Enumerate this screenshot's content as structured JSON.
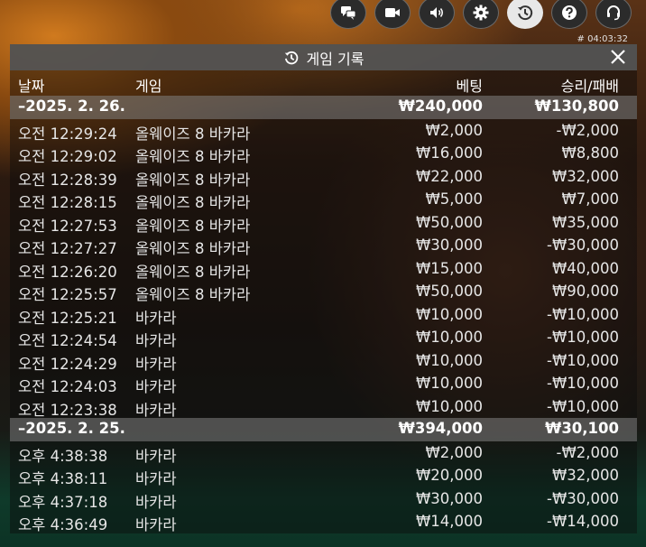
{
  "toolbar": {
    "buttons": [
      {
        "icon": "chat-icon"
      },
      {
        "icon": "video-icon"
      },
      {
        "icon": "volume-icon"
      },
      {
        "icon": "gear-icon"
      },
      {
        "icon": "history-icon",
        "active": true
      },
      {
        "icon": "help-icon"
      },
      {
        "icon": "headset-icon"
      }
    ],
    "clock": "# 04:03:32"
  },
  "panel": {
    "title": "게임 기록",
    "columns": {
      "date": "날짜",
      "game": "게임",
      "bet": "베팅",
      "winloss": "승리/패배"
    },
    "groups": [
      {
        "date": "–2025. 2. 26.",
        "bet_total": "₩240,000",
        "win_total": "₩130,800",
        "rows": [
          {
            "time": "오전 12:29:24",
            "game": "올웨이즈 8 바카라",
            "bet": "₩2,000",
            "win": "-₩2,000"
          },
          {
            "time": "오전 12:29:02",
            "game": "올웨이즈 8 바카라",
            "bet": "₩16,000",
            "win": "₩8,800"
          },
          {
            "time": "오전 12:28:39",
            "game": "올웨이즈 8 바카라",
            "bet": "₩22,000",
            "win": "₩32,000"
          },
          {
            "time": "오전 12:28:15",
            "game": "올웨이즈 8 바카라",
            "bet": "₩5,000",
            "win": "₩7,000"
          },
          {
            "time": "오전 12:27:53",
            "game": "올웨이즈 8 바카라",
            "bet": "₩50,000",
            "win": "₩35,000"
          },
          {
            "time": "오전 12:27:27",
            "game": "올웨이즈 8 바카라",
            "bet": "₩30,000",
            "win": "-₩30,000"
          },
          {
            "time": "오전 12:26:20",
            "game": "올웨이즈 8 바카라",
            "bet": "₩15,000",
            "win": "₩40,000"
          },
          {
            "time": "오전 12:25:57",
            "game": "올웨이즈 8 바카라",
            "bet": "₩50,000",
            "win": "₩90,000"
          },
          {
            "time": "오전 12:25:21",
            "game": "바카라",
            "bet": "₩10,000",
            "win": "-₩10,000"
          },
          {
            "time": "오전 12:24:54",
            "game": "바카라",
            "bet": "₩10,000",
            "win": "-₩10,000"
          },
          {
            "time": "오전 12:24:29",
            "game": "바카라",
            "bet": "₩10,000",
            "win": "-₩10,000"
          },
          {
            "time": "오전 12:24:03",
            "game": "바카라",
            "bet": "₩10,000",
            "win": "-₩10,000"
          },
          {
            "time": "오전 12:23:38",
            "game": "바카라",
            "bet": "₩10,000",
            "win": "-₩10,000"
          }
        ]
      },
      {
        "date": "–2025. 2. 25.",
        "bet_total": "₩394,000",
        "win_total": "₩30,100",
        "rows": [
          {
            "time": "오후 4:38:38",
            "game": "바카라",
            "bet": "₩2,000",
            "win": "-₩2,000"
          },
          {
            "time": "오후 4:38:11",
            "game": "바카라",
            "bet": "₩20,000",
            "win": "₩32,000"
          },
          {
            "time": "오후 4:37:18",
            "game": "바카라",
            "bet": "₩30,000",
            "win": "-₩30,000"
          },
          {
            "time": "오후 4:36:49",
            "game": "바카라",
            "bet": "₩14,000",
            "win": "-₩14,000"
          }
        ]
      }
    ]
  }
}
